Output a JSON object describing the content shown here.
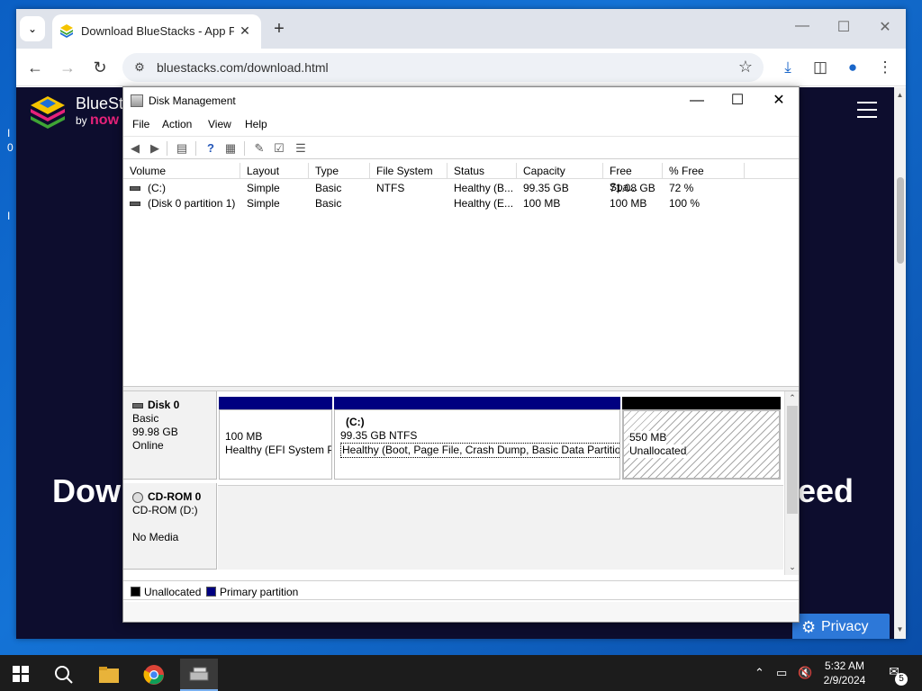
{
  "browser": {
    "tab_title": "Download BlueStacks - App Pla",
    "url": "bluestacks.com/download.html"
  },
  "webpage": {
    "brand_name": "BlueSta",
    "brand_by": "by",
    "brand_now": "now",
    "hero_left": "Dow",
    "hero_right": "eed",
    "privacy_label": "Privacy"
  },
  "desktop": {
    "left_chars": [
      "I",
      "0",
      "I"
    ]
  },
  "disk_management": {
    "title": "Disk Management",
    "menu": [
      "File",
      "Action",
      "View",
      "Help"
    ],
    "columns": [
      "Volume",
      "Layout",
      "Type",
      "File System",
      "Status",
      "Capacity",
      "Free Spa...",
      "% Free"
    ],
    "volumes": [
      {
        "volume": "(C:)",
        "layout": "Simple",
        "type": "Basic",
        "fs": "NTFS",
        "status": "Healthy (B...",
        "capacity": "99.35 GB",
        "free": "71.08 GB",
        "pct": "72 %"
      },
      {
        "volume": "(Disk 0 partition 1)",
        "layout": "Simple",
        "type": "Basic",
        "fs": "",
        "status": "Healthy (E...",
        "capacity": "100 MB",
        "free": "100 MB",
        "pct": "100 %"
      }
    ],
    "disk0": {
      "name": "Disk 0",
      "type": "Basic",
      "size": "99.98 GB",
      "state": "Online",
      "partitions": [
        {
          "label": "",
          "size": "100 MB",
          "status": "Healthy (EFI System P"
        },
        {
          "label": "(C:)",
          "size": "99.35 GB NTFS",
          "status": "Healthy (Boot, Page File, Crash Dump, Basic Data Partition)"
        },
        {
          "label": "",
          "size": "550 MB",
          "status": "Unallocated"
        }
      ]
    },
    "cdrom": {
      "name": "CD-ROM 0",
      "drive": "CD-ROM (D:)",
      "media": "No Media"
    },
    "legend": {
      "unallocated": "Unallocated",
      "primary": "Primary partition"
    },
    "colors": {
      "primary": "#000080",
      "unallocated": "#000000"
    }
  },
  "taskbar": {
    "time": "5:32 AM",
    "date": "2/9/2024",
    "notification_count": "5"
  }
}
